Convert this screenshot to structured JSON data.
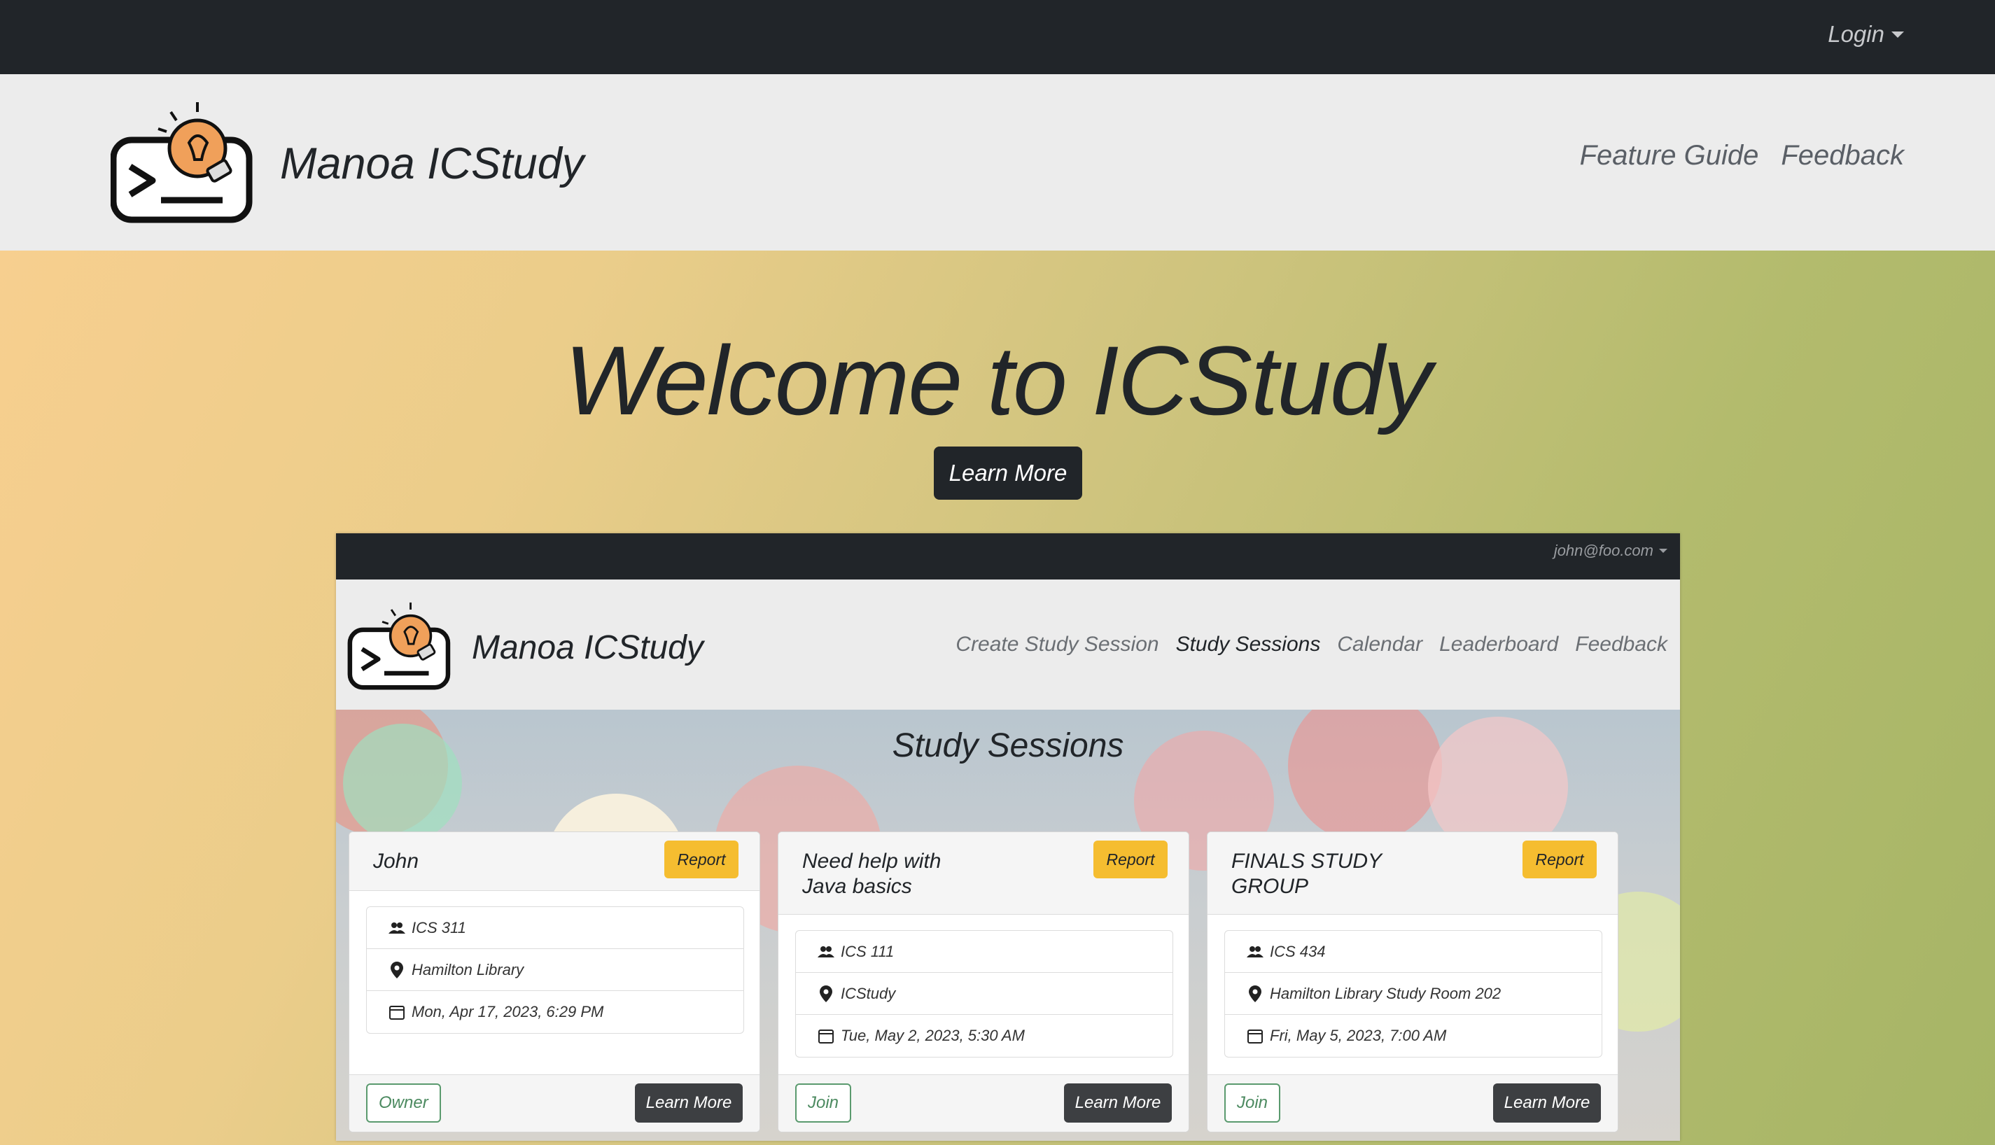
{
  "topbar": {
    "login_label": "Login"
  },
  "header": {
    "brand": "Manoa ICStudy",
    "nav": [
      "Feature Guide",
      "Feedback"
    ]
  },
  "hero": {
    "title": "Welcome to ICStudy",
    "button": "Learn More"
  },
  "preview": {
    "user_email": "john@foo.com",
    "brand": "Manoa ICStudy",
    "nav": [
      "Create Study Session",
      "Study Sessions",
      "Calendar",
      "Leaderboard",
      "Feedback"
    ],
    "active_nav": "Study Sessions",
    "page_title": "Study Sessions",
    "cards": [
      {
        "title": "John",
        "report_label": "Report",
        "course": "ICS 311",
        "location": "Hamilton Library",
        "datetime": "Mon, Apr 17, 2023, 6:29 PM",
        "action_label": "Owner",
        "more_label": "Learn More"
      },
      {
        "title": "Need help with\nJava basics",
        "report_label": "Report",
        "course": "ICS 111",
        "location": "ICStudy",
        "datetime": "Tue, May 2, 2023, 5:30 AM",
        "action_label": "Join",
        "more_label": "Learn More"
      },
      {
        "title": "FINALS STUDY\nGROUP",
        "report_label": "Report",
        "course": "ICS 434",
        "location": "Hamilton Library Study Room 202",
        "datetime": "Fri, May 5, 2023, 7:00 AM",
        "action_label": "Join",
        "more_label": "Learn More"
      }
    ]
  },
  "colors": {
    "topbar": "#212529",
    "header_bg": "#ececec",
    "report_button": "#f5bd30",
    "join_outline": "#5a9a6e",
    "learn_more_dark": "#3d3f42"
  },
  "icons": [
    "logo-icon",
    "caret-down-icon",
    "users-icon",
    "location-pin-icon",
    "calendar-icon"
  ]
}
